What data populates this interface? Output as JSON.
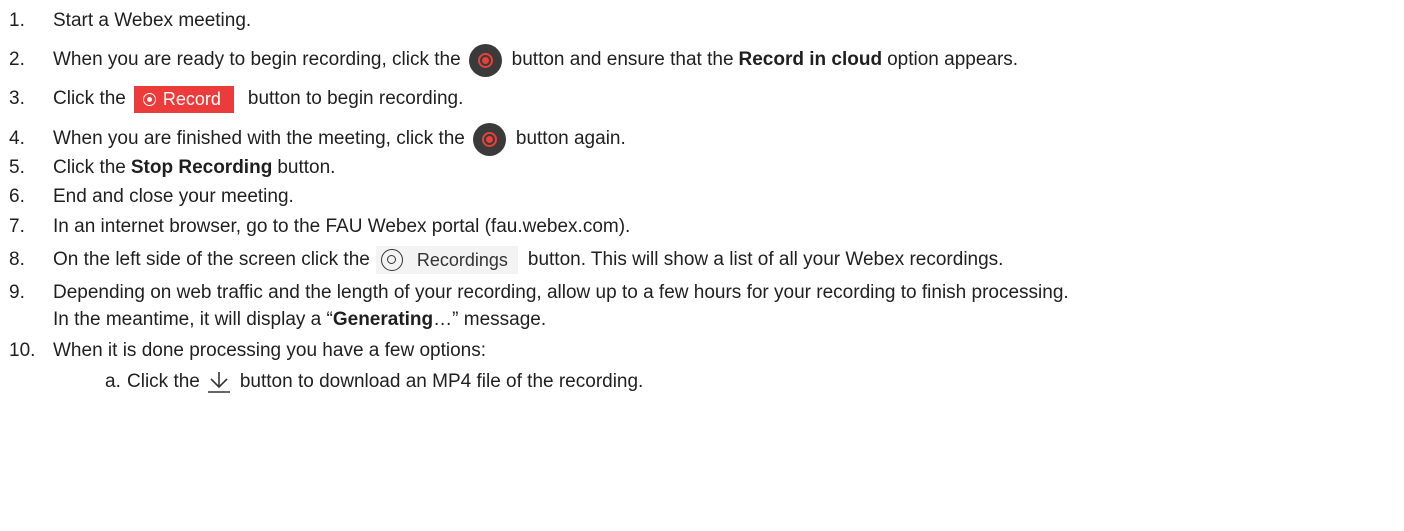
{
  "steps": [
    {
      "num": "1.",
      "text": "Start a Webex meeting."
    },
    {
      "num": "2.",
      "pre": "When you are ready to begin recording, click the",
      "post": "button and ensure that the",
      "bold": "Record in cloud",
      "tail": "option appears."
    },
    {
      "num": "3.",
      "pre": "Click the",
      "button_label": "Record",
      "post": "button to begin recording."
    },
    {
      "num": "4.",
      "pre": "When you are finished with the meeting, click the",
      "post": "button again."
    },
    {
      "num": "5.",
      "pre": "Click the",
      "bold": "Stop Recording",
      "post": "button."
    },
    {
      "num": "6.",
      "text": "End and close your meeting."
    },
    {
      "num": "7.",
      "text": "In an internet browser, go to the FAU Webex portal (fau.webex.com)."
    },
    {
      "num": "8.",
      "pre": "On the left side of the screen click the",
      "button_label": "Recordings",
      "post": "button. This will show a list of all your Webex recordings."
    },
    {
      "num": "9.",
      "line1": "Depending on web traffic and the length of your recording, allow up to a few hours for your recording to finish processing.",
      "line2_pre": "In the meantime, it will display a “",
      "bold": "Generating",
      "line2_post": "…” message."
    },
    {
      "num": "10.",
      "text": "When it is done processing you have a few options:"
    }
  ],
  "substeps": [
    {
      "letter": "a.",
      "pre": "Click the",
      "post": "button to download an MP4 file of the recording."
    }
  ],
  "icons": {
    "record_toggle": "record-circle-icon",
    "record_button": "record-dot-icon",
    "recordings": "recordings-icon",
    "download": "download-arrow-icon"
  },
  "colors": {
    "record_red": "#ec3b3b",
    "dark_circle": "#3a3a3a",
    "text": "#1f1f1f"
  }
}
